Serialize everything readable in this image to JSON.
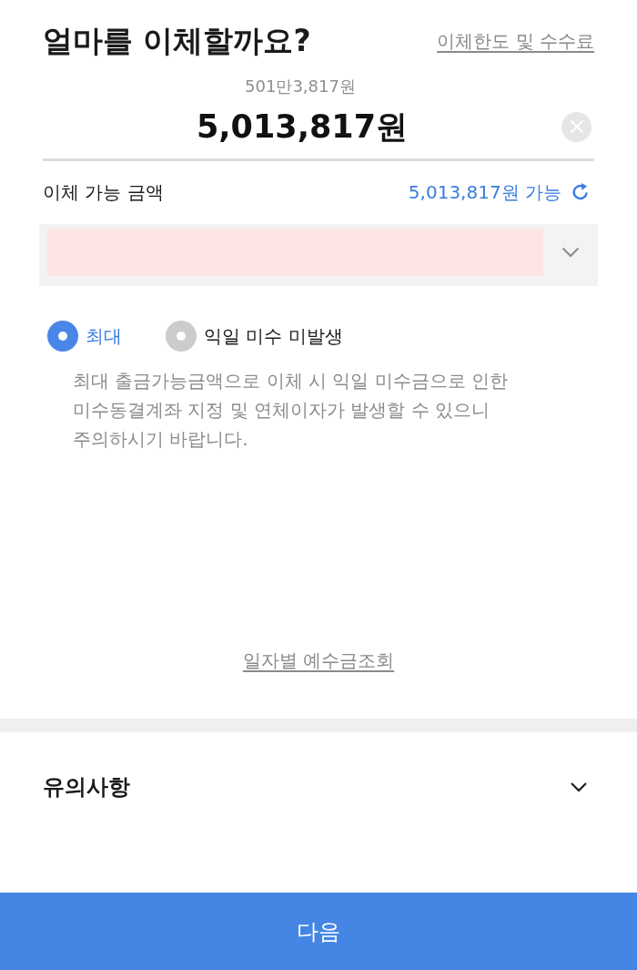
{
  "header": {
    "title": "얼마를 이체할까요?",
    "limits_link": "이체한도 및 수수료"
  },
  "amount": {
    "in_words": "501만3,817원",
    "value": "5,013,817원"
  },
  "available": {
    "label": "이체 가능 금액",
    "value": "5,013,817원 가능"
  },
  "options": [
    {
      "label": "최대",
      "selected": true
    },
    {
      "label": "익일 미수 미발생",
      "selected": false
    }
  ],
  "notice": "최대 출금가능금액으로 이체 시 익일 미수금으로 인한 미수동결계좌 지정 및 연체이자가 발생할 수 있으니 주의하시기 바랍니다.",
  "history_link": "일자별 예수금조회",
  "cautions": {
    "title": "유의사항",
    "expanded": false
  },
  "next_button": "다음"
}
